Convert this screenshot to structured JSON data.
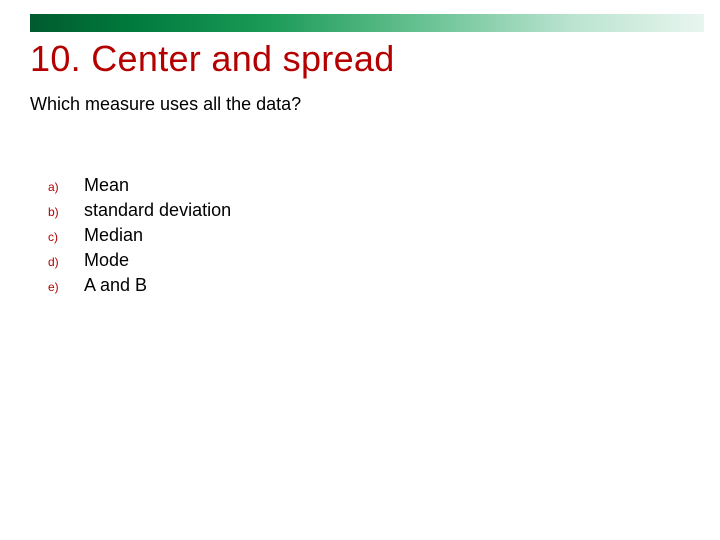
{
  "slide": {
    "title": "10. Center and spread",
    "question": "Which measure uses all the data?",
    "options": [
      {
        "letter": "a)",
        "text": "Mean"
      },
      {
        "letter": "b)",
        "text": "standard deviation"
      },
      {
        "letter": "c)",
        "text": "Median"
      },
      {
        "letter": "d)",
        "text": "Mode"
      },
      {
        "letter": "e)",
        "text": "A and B"
      }
    ]
  }
}
